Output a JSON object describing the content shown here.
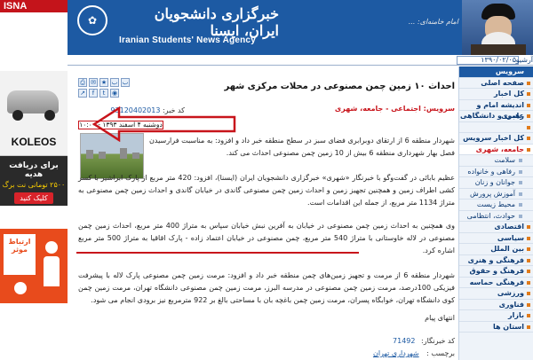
{
  "header": {
    "isna_fa": "خبرگزاری دانشجویان ایران، ایسنا",
    "isna_en": "Iranian Students' News Agency",
    "quote": "امام خامنه‌ای: ..."
  },
  "ads": {
    "isna_badge": "ISNA",
    "car_label": "KOLEOS",
    "mobile_line1": "برای دریافت هدیه",
    "mobile_line2": "۲۵۰۰ تومانی نت برگ",
    "mobile_cta": "کلیک کنید",
    "box_text": "ارتباط موثر"
  },
  "topbar": {
    "date": "۱۳۹۰/۰۲/۰۵",
    "archive": "آرشیو"
  },
  "nav": {
    "items": [
      {
        "label": "سرویس",
        "type": "head"
      },
      {
        "label": "صفحه اصلی",
        "type": "item"
      },
      {
        "label": "کل اخبار",
        "type": "item"
      },
      {
        "label": "اندیشه امام و رهبری",
        "type": "item"
      },
      {
        "label": "علمی و دانشگاهی",
        "type": "item"
      },
      {
        "label": "",
        "type": "item"
      },
      {
        "label": "کل اخبار سرویس",
        "type": "item"
      },
      {
        "label": "جامعه، شهری",
        "type": "active"
      },
      {
        "label": "سلامت",
        "type": "sub"
      },
      {
        "label": "رفاهی و خانواده",
        "type": "sub"
      },
      {
        "label": "جوانان و زنان",
        "type": "sub"
      },
      {
        "label": "آموزش پرورش",
        "type": "sub"
      },
      {
        "label": "محیط زیست",
        "type": "sub"
      },
      {
        "label": "حوادث، انتظامی",
        "type": "sub"
      },
      {
        "label": "اقتصادی",
        "type": "item"
      },
      {
        "label": "سیاسی",
        "type": "item"
      },
      {
        "label": "بین الملل",
        "type": "item"
      },
      {
        "label": "فرهنگی و هنری",
        "type": "item"
      },
      {
        "label": "فرهنگ و حقوق",
        "type": "item"
      },
      {
        "label": "فرهنگی حماسه",
        "type": "item"
      },
      {
        "label": "ورزشی",
        "type": "item"
      },
      {
        "label": "فناوری",
        "type": "item"
      },
      {
        "label": "بازار",
        "type": "item"
      },
      {
        "label": "استان ها",
        "type": "item"
      }
    ]
  },
  "article": {
    "headline": "احداث ۱۰ زمین چمن مصنوعی در محلات مرکزی شهر",
    "service": "سرویس: اجتماعی - جامعه، شهری",
    "news_code_label": "کد خبر:",
    "news_code": "93120402013",
    "date_line": "دوشنبه ۴ اسفند ۱۳۹۳ - ۱۰:۰۰",
    "lead": "شهردار منطقه 6 از ارتقای دوبرابری فضای سبز در سطح منطقه خبر داد و افزود: به مناسبت فرارسیدن فصل بهار شهرداری منطقه 6 بیش از 10 زمین چمن مصنوعی احداث می کند.",
    "p1": "عظیم بابائی در گفت‌وگو با خبرنگار «شهری» خبرگزاری دانشجویان ایران (ایسنا)، افزود: 420 متر مربع از پارک ابراشیر با کسر کشی اطراف زمین و همچنین تجهیز زمین و احداث زمین چمن مصنوعی گاندی در خیابان گاندی و احداث زمین چمن مصنوعی به متراژ 1134 متر مربع، از جمله این اقدامات است.",
    "p2": "وی همچنین به احداث زمین چمن مصنوعی در خیابان به آفرین نبش خیابان سپاس به متراژ 400 متر مربع، احداث زمین چمن مصنوعی در لاله خاوستانی با متراژ 540 متر مربع، چمن مصنوعی در خیابان اعتماد زاده - پارک اقاقیا به متراژ 500 متر مربع اشاره کرد.",
    "p3": "شهردار منطقه 6 از مرمت و تجهیز زمین‌های چمن منطقه خبر داد و افزود: مرمت زمین چمن مصنوعی پارک لاله با پیشرفت فیزیکی 100درصد، مرمت زمین چمن مصنوعی در مدرسه البرز، مرمت زمین چمن مصنوعی دانشگاه تهران، مرمت زمین چمن کوی دانشگاه تهران، خوابگاه پسران، مرمت زمین چمن باغچه بان با مساحتی بالغ بر 922 مترمربع نیز برودی انجام می شود.",
    "end_text": "انتهای پیام",
    "footer_code_label": "کد خبرنگار:",
    "footer_code": "71492",
    "tags_label": "برچسب :",
    "tags": [
      "شهرداری تهران"
    ]
  },
  "colors": {
    "brand_blue": "#1d5aa3",
    "accent_red": "#c8141b",
    "nav_bg": "#eef3f9"
  }
}
